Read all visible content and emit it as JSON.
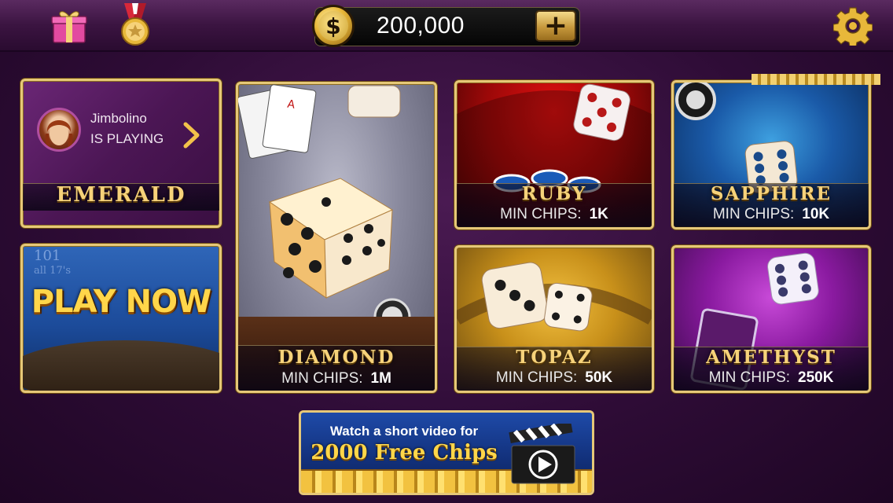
{
  "topbar": {
    "balance": "200,000",
    "currency_symbol": "$",
    "add_label": "+"
  },
  "tiles": {
    "emerald": {
      "name": "EMERALD",
      "player_name": "Jimbolino",
      "player_status": "IS PLAYING"
    },
    "play_now": {
      "label": "PLAY NOW",
      "bg_text_1": "101",
      "bg_text_2": "all 17's"
    },
    "diamond": {
      "name": "DIAMOND",
      "min_label": "MIN CHIPS:",
      "min_value": "1M"
    },
    "ruby": {
      "name": "RUBY",
      "min_label": "MIN CHIPS:",
      "min_value": "1K"
    },
    "sapphire": {
      "name": "SAPPHIRE",
      "min_label": "MIN CHIPS:",
      "min_value": "10K"
    },
    "topaz": {
      "name": "TOPAZ",
      "min_label": "MIN CHIPS:",
      "min_value": "50K"
    },
    "amethyst": {
      "name": "AMETHYST",
      "min_label": "MIN CHIPS:",
      "min_value": "250K"
    }
  },
  "banner": {
    "line1": "Watch a short video for",
    "line2": "2000 Free Chips"
  },
  "icons": {
    "gift": "gift-icon",
    "medal": "medal-icon",
    "coin": "dollar-coin-icon",
    "settings": "gear-icon",
    "chevron": "chevron-right-icon",
    "video": "clapperboard-play-icon"
  },
  "colors": {
    "gold_border": "#e6c878",
    "label_gold": "#f6d27a",
    "background": "#2e0c36"
  }
}
